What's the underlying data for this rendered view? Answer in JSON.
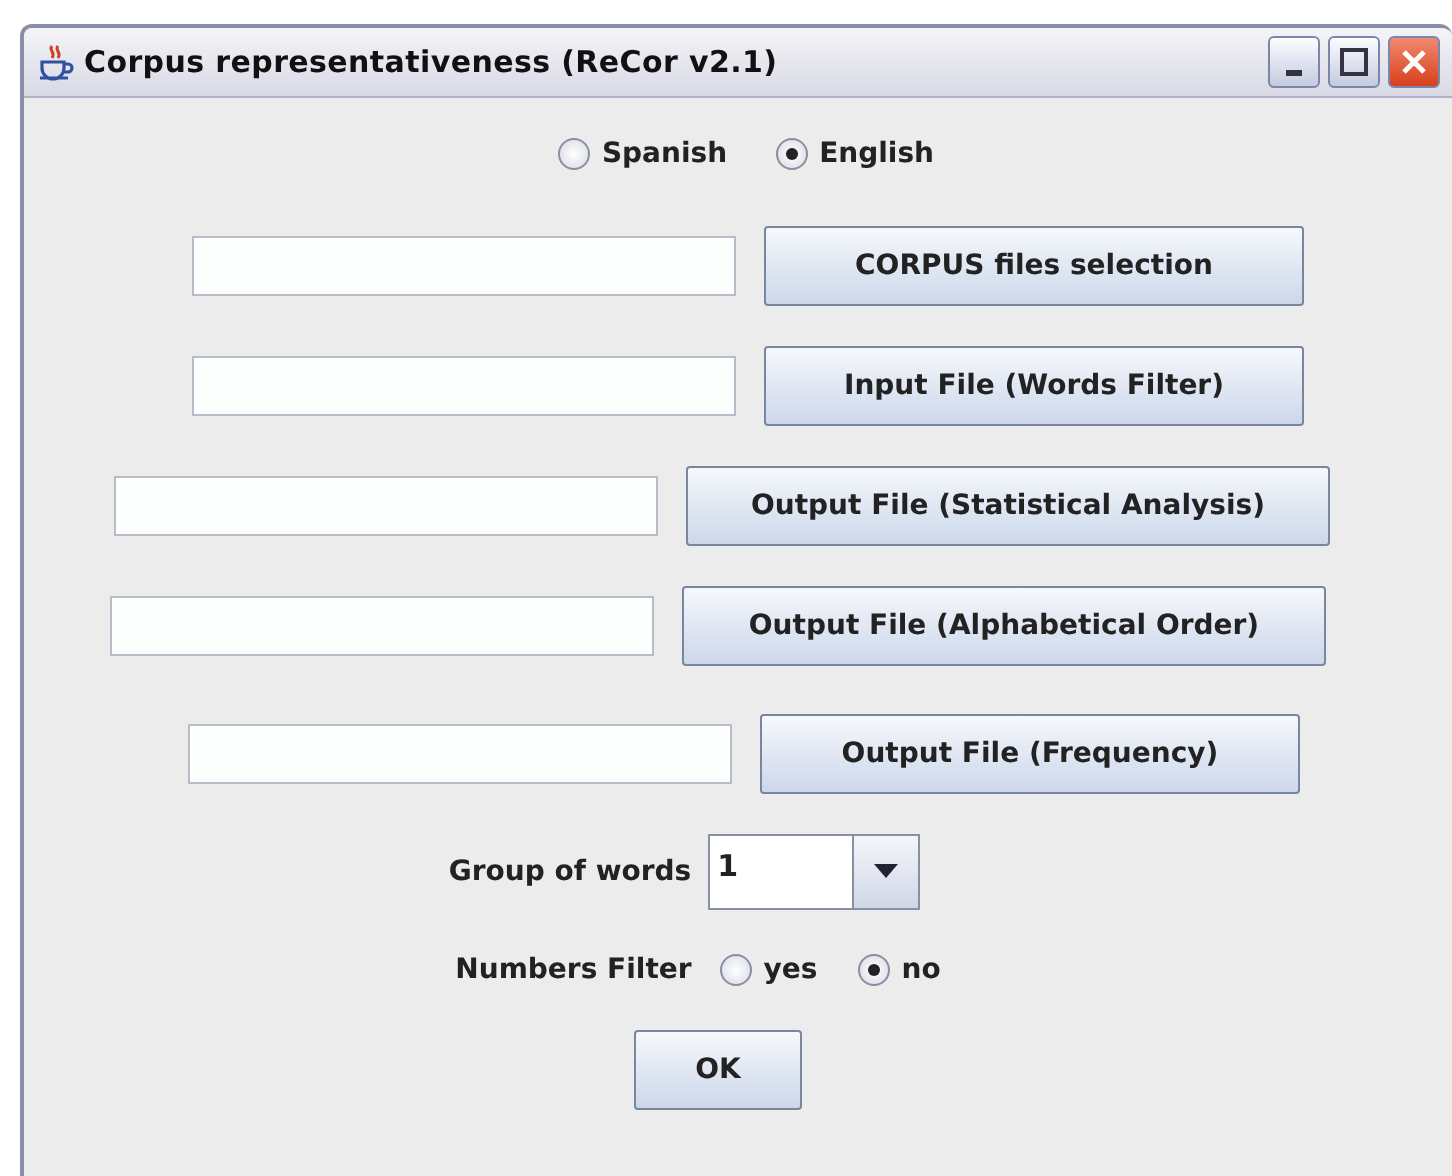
{
  "window": {
    "title": "Corpus representativeness (ReCor v2.1)"
  },
  "language": [
    {
      "label": "Spanish",
      "selected": false
    },
    {
      "label": "English",
      "selected": true
    }
  ],
  "file_rows": [
    {
      "value": "",
      "button": "CORPUS files selection"
    },
    {
      "value": "",
      "button": "Input File (Words Filter)"
    },
    {
      "value": "",
      "button": "Output File (Statistical Analysis)"
    },
    {
      "value": "",
      "button": "Output File  (Alphabetical Order)"
    },
    {
      "value": "",
      "button": "Output File  (Frequency)"
    }
  ],
  "group_of_words": {
    "label": "Group of words",
    "value": "1"
  },
  "numbers_filter": {
    "label": "Numbers Filter",
    "options": [
      {
        "label": "yes",
        "selected": false
      },
      {
        "label": "no",
        "selected": true
      }
    ]
  },
  "ok_button": "OK"
}
